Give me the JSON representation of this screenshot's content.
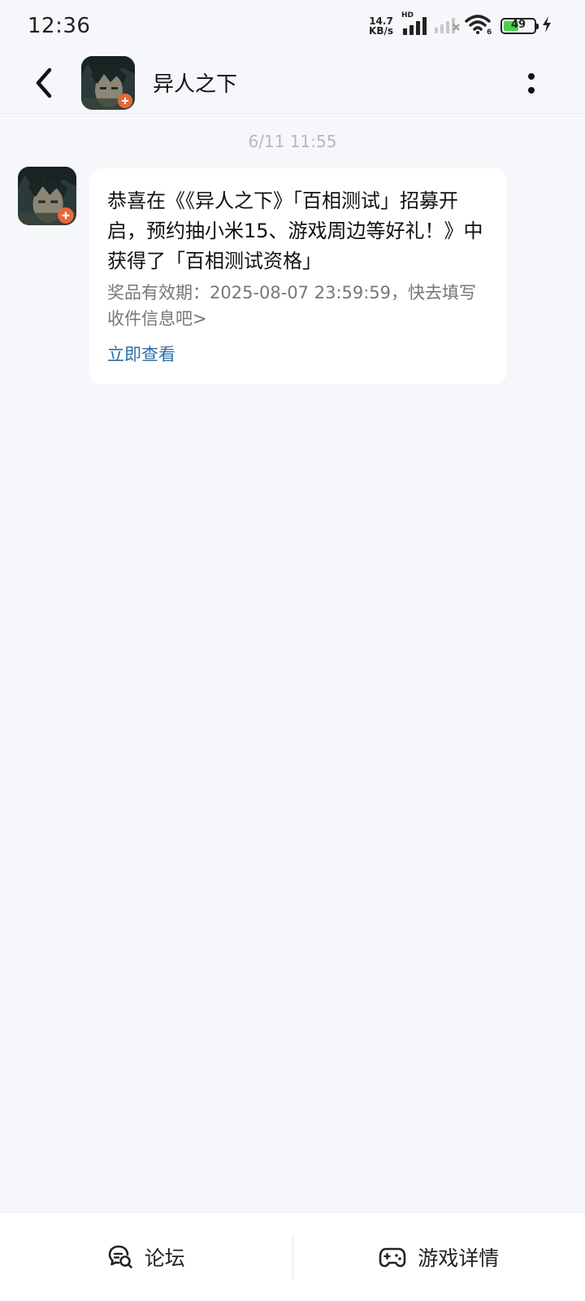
{
  "status_bar": {
    "time": "12:36",
    "net_speed_value": "14.7",
    "net_speed_unit": "KB/s",
    "hd_label": "HD",
    "battery_level": "49",
    "icons": [
      "signal-icon",
      "signal-no-service-icon",
      "wifi-icon",
      "battery-icon",
      "charging-icon"
    ]
  },
  "header": {
    "title": "异人之下",
    "back_icon": "chevron-left-icon",
    "more_icon": "more-vertical-icon"
  },
  "chat": {
    "timestamp": "6/11  11:55",
    "message": {
      "title": "恭喜在《《异人之下》「百相测试」招募开启，预约抽小米15、游戏周边等好礼！》中获得了「百相测试资格」",
      "desc": "奖品有效期：2025-08-07 23:59:59，快去填写收件信息吧>",
      "link": "立即查看"
    }
  },
  "bottom_bar": {
    "forum_label": "论坛",
    "forum_icon": "forum-chat-icon",
    "game_detail_label": "游戏详情",
    "game_detail_icon": "gamepad-icon"
  },
  "colors": {
    "background": "#f5f7fa",
    "link": "#2d6ea8",
    "battery": "#4cd04c"
  }
}
